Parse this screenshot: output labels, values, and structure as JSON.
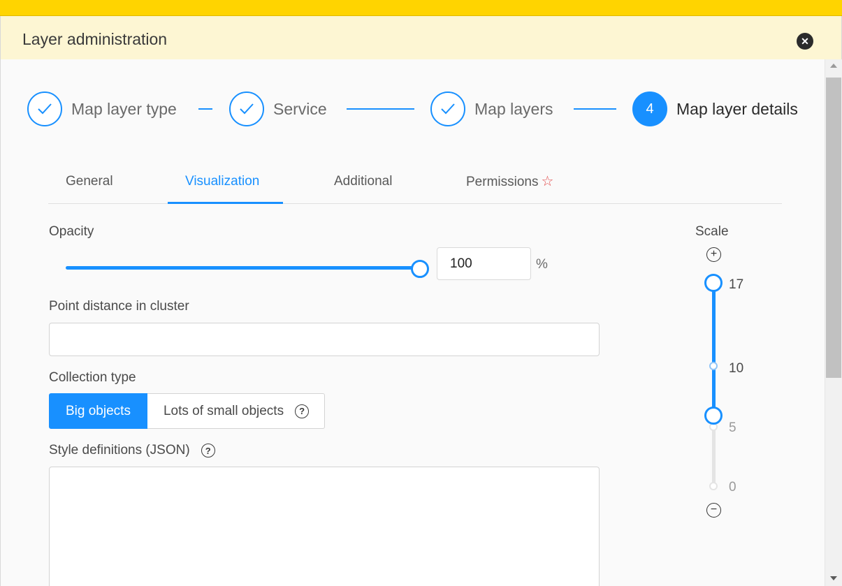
{
  "dialog": {
    "title": "Layer administration"
  },
  "steps": [
    {
      "label": "Map layer type",
      "status": "done"
    },
    {
      "label": "Service",
      "status": "done"
    },
    {
      "label": "Map layers",
      "status": "done"
    },
    {
      "label": "Map layer details",
      "status": "active",
      "number": "4"
    }
  ],
  "tabs": [
    {
      "label": "General"
    },
    {
      "label": "Visualization",
      "active": true
    },
    {
      "label": "Additional"
    },
    {
      "label": "Permissions",
      "icon": "star-icon"
    }
  ],
  "opacity": {
    "label": "Opacity",
    "value": "100",
    "unit": "%",
    "slider_fraction": 1.0
  },
  "cluster": {
    "label": "Point distance in cluster",
    "value": ""
  },
  "collection": {
    "label": "Collection type",
    "options": [
      {
        "label": "Big objects",
        "checked": true
      },
      {
        "label": "Lots of small objects",
        "checked": false
      }
    ]
  },
  "style_defs": {
    "label": "Style definitions (JSON)",
    "value": ""
  },
  "scale": {
    "label": "Scale",
    "marks": [
      "17",
      "10",
      "5",
      "0"
    ],
    "range_min": 5,
    "range_max": 17
  },
  "colors": {
    "accent": "#1890ff",
    "header_bg": "#fdf6d3",
    "topbar": "#ffd400",
    "required_star": "#e24b4b"
  }
}
